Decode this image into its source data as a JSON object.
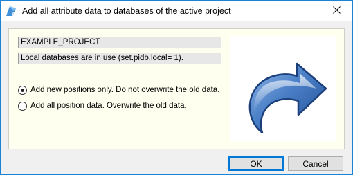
{
  "window": {
    "title": "Add all attribute data to databases of the active project",
    "icon": "g4-app-icon",
    "close_icon": "close-icon"
  },
  "info": {
    "project_name": "EXAMPLE_PROJECT",
    "database_status": "Local databases are in use (set.pidb.local= 1)."
  },
  "options": [
    {
      "label": "Add new positions only. Do not overwrite the old data.",
      "selected": true
    },
    {
      "label": "Add all position data. Overwrite the old data.",
      "selected": false
    }
  ],
  "image": {
    "icon": "redo-arrow-icon"
  },
  "buttons": {
    "ok_label": "OK",
    "cancel_label": "Cancel"
  },
  "colors": {
    "accent": "#0078d7",
    "panel_bg": "#fffff0",
    "arrow_blue": "#2f62a8"
  }
}
